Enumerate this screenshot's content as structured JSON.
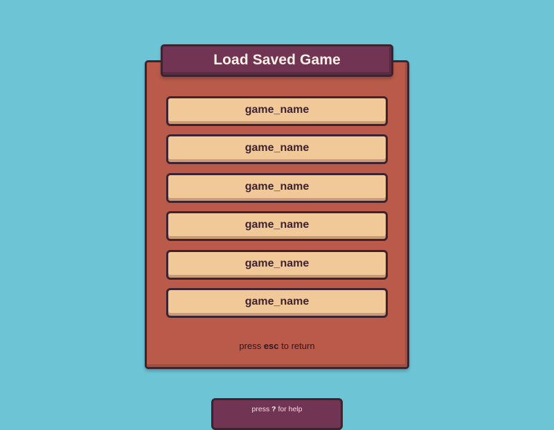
{
  "dialog": {
    "title": "Load Saved Game"
  },
  "saves": [
    {
      "name": "game_name"
    },
    {
      "name": "game_name"
    },
    {
      "name": "game_name"
    },
    {
      "name": "game_name"
    },
    {
      "name": "game_name"
    },
    {
      "name": "game_name"
    }
  ],
  "return_hint": {
    "prefix": "press ",
    "key": "esc",
    "suffix": " to return"
  },
  "help_hint": {
    "prefix": "press ",
    "key": "?",
    "suffix": " for help"
  },
  "colors": {
    "background": "#6cc4d5",
    "panel": "#b95a4a",
    "title_bar": "#713553",
    "slot": "#f1c898",
    "outline": "#3d2330",
    "title_text": "#fdf1e6"
  }
}
